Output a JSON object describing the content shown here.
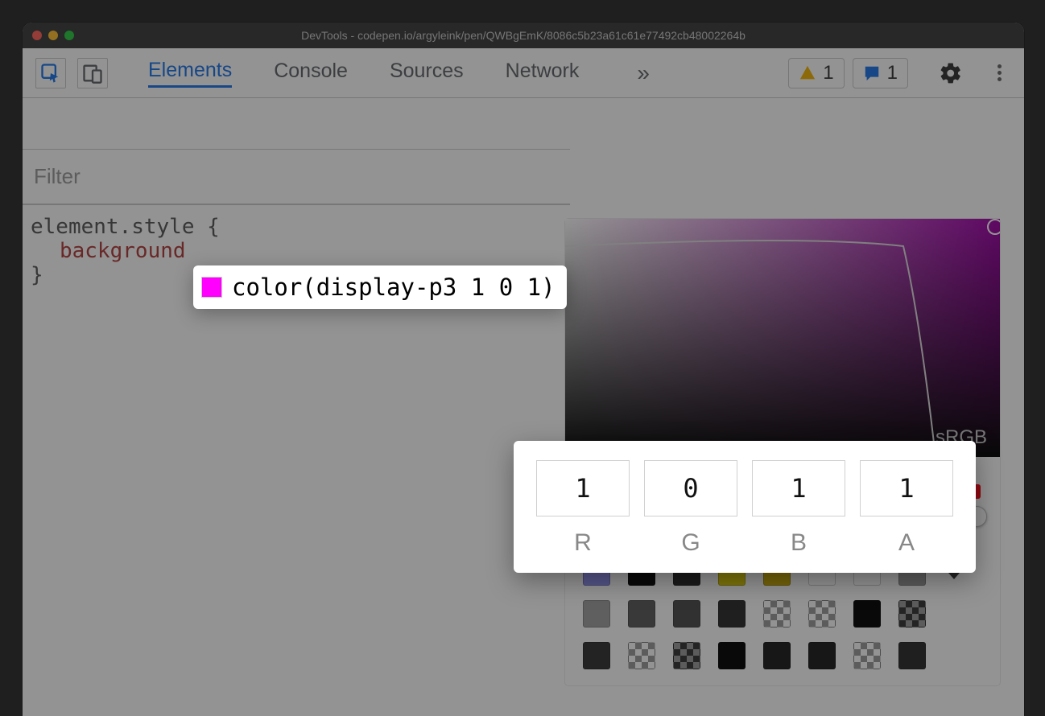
{
  "window": {
    "title": "DevTools - codepen.io/argyleink/pen/QWBgEmK/8086c5b23a61c61e77492cb48002264b"
  },
  "tabs": {
    "items": [
      "Elements",
      "Console",
      "Sources",
      "Network"
    ],
    "active": "Elements",
    "overflow_glyph": "»"
  },
  "badges": {
    "warnings": "1",
    "issues": "1"
  },
  "styles": {
    "filter_placeholder": "Filter",
    "selector": "element.style",
    "open_brace": "{",
    "close_brace": "}",
    "property_name": "background",
    "property_value": "color(display-p3 1 0 1)"
  },
  "color_picker": {
    "gamut_label": "sRGB",
    "current_color": "#a000a8",
    "channels": {
      "R": "1",
      "G": "0",
      "B": "1",
      "A": "1"
    },
    "palette": [
      [
        "#8f8ff0",
        "#000000",
        "#222222",
        "#d8c800",
        "#c8a800",
        "#ffffff",
        "#ffffff",
        "#9a9a9a"
      ],
      [
        "#a0a0a0",
        "#5a5a5a",
        "#4a4a4a",
        "#2a2a2a",
        "checker",
        "checker",
        "#000000",
        "checker-dark"
      ],
      [
        "#303030",
        "checker",
        "checker-dark",
        "#000000",
        "#1a1a1a",
        "#1a1a1a",
        "checker",
        "#2a2a2a"
      ]
    ]
  }
}
